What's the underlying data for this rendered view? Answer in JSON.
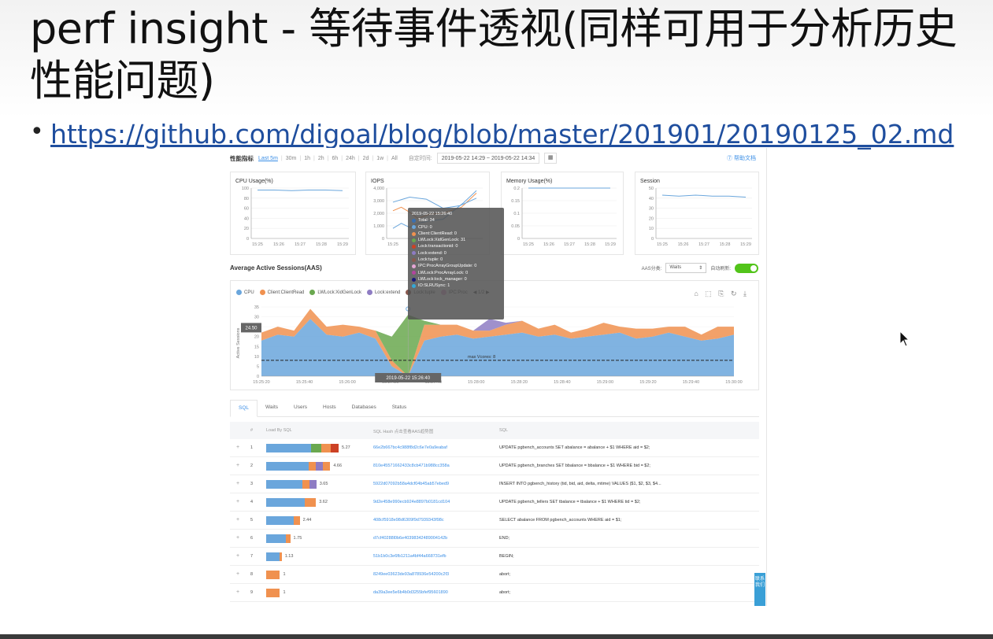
{
  "slide": {
    "title": "perf insight - 等待事件透视(同样可用于分析历史性能问题)",
    "bullet": "•",
    "link": "https://github.com/digoal/blog/blob/master/201901/20190125_02.md"
  },
  "dashboard": {
    "header_label": "性能指标",
    "ranges": [
      "Last 5m",
      "30m",
      "1h",
      "2h",
      "6h",
      "24h",
      "2d",
      "1w",
      "All"
    ],
    "custom_time_label": "自定时间:",
    "time_range": "2019-05-22 14:29  ~  2019-05-22 14:34",
    "calendar_icon": "calendar-icon",
    "help_label": "⑦ 帮助文档",
    "cards": [
      {
        "title": "CPU Usage(%)",
        "yticks": [
          "100",
          "80",
          "60",
          "40",
          "20",
          "0"
        ],
        "xticks": [
          "15:25",
          "15:26",
          "15:27",
          "15:28",
          "15:29"
        ]
      },
      {
        "title": "IOPS",
        "yticks": [
          "4,000",
          "3,000",
          "2,000",
          "1,000",
          "0"
        ],
        "xticks": [
          "15:25",
          "15:26"
        ]
      },
      {
        "title": "Memory Usage(%)",
        "yticks": [
          "0.2",
          "0.15",
          "0.1",
          "0.05",
          "0"
        ],
        "xticks": [
          "15:25",
          "15:26",
          "15:27",
          "15:28",
          "15:29"
        ]
      },
      {
        "title": "Session",
        "yticks": [
          "50",
          "40",
          "30",
          "20",
          "10",
          "0"
        ],
        "xticks": [
          "15:25",
          "15:26",
          "15:27",
          "15:28",
          "15:29"
        ]
      }
    ],
    "aas": {
      "title": "Average Active Sessions(AAS)",
      "dimension_label": "AAS分类:",
      "dimension_value": "Waits",
      "auto_refresh_label": "自动刷新:",
      "legend": [
        {
          "name": "CPU",
          "color": "#6aa6dc"
        },
        {
          "name": "Client:ClientRead",
          "color": "#f0914f"
        },
        {
          "name": "LWLock:XidGenLock",
          "color": "#6aa84f"
        },
        {
          "name": "Lock:extend",
          "color": "#8e7cc3"
        },
        {
          "name": "Lock:tuple",
          "color": "#8b5a4f"
        },
        {
          "name": "IPC:Proc",
          "color": "#e6a6d6"
        }
      ],
      "legend_pager": "◀ 1/2 ▶",
      "toolbox": "⌂ ⬚ ⎘ ↻ ⤓",
      "y_label": "Active Sessions",
      "yticks": [
        "35",
        "30",
        "25",
        "20",
        "15",
        "10",
        "5",
        "0"
      ],
      "xticks": [
        "15:25:20",
        "15:25:40",
        "15:26:00",
        "15:27:20",
        "15:27:40",
        "15:28:00",
        "15:28:20",
        "15:28:40",
        "15:29:00",
        "15:29:20",
        "15:29:40",
        "15:30:00"
      ],
      "pointer_value": "24.50",
      "pointer_time": "2019-05-22 15:26:40",
      "max_vcores_label": "max Vcores: 8"
    },
    "tooltip": {
      "time": "2019-05-22 15:26:40",
      "items": [
        {
          "text": "Total: 34",
          "color": "#3a6fb0"
        },
        {
          "text": "CPU: 0",
          "color": "#6aa6dc"
        },
        {
          "text": "Client:ClientRead: 0",
          "color": "#f0914f"
        },
        {
          "text": "LWLock:XidGenLock: 31",
          "color": "#6aa84f"
        },
        {
          "text": "Lock:transactionid: 0",
          "color": "#cc4125"
        },
        {
          "text": "Lock:extend: 0",
          "color": "#8e7cc3"
        },
        {
          "text": "Lock:tuple: 0",
          "color": "#8b5a4f"
        },
        {
          "text": "IPC:ProcArrayGroupUpdate: 0",
          "color": "#e6a6d6"
        },
        {
          "text": "LWLock:ProcArrayLock: 0",
          "color": "#b4449e"
        },
        {
          "text": "LWLock:lock_manager: 0",
          "color": "#1a1a7a"
        },
        {
          "text": "IO:SLRUSync: 1",
          "color": "#35a7d6"
        }
      ]
    },
    "tabs": [
      "SQL",
      "Waits",
      "Users",
      "Hosts",
      "Databases",
      "Status"
    ],
    "table": {
      "headers": [
        "#",
        "Load By SQL",
        "SQL Hash 点击查看AAS趋势图",
        "SQL"
      ],
      "rows": [
        {
          "num": "1",
          "load": "5.27",
          "hash": "66e2b667bc4c988f8d2c6e7e0a9eabaf",
          "sql": "UPDATE pgbench_accounts SET abalance = abalance + $1 WHERE aid = $2;",
          "bar": [
            [
              0.62,
              "#6aa6dc"
            ],
            [
              0.14,
              "#6aa84f"
            ],
            [
              0.13,
              "#f0914f"
            ],
            [
              0.11,
              "#cc4125"
            ]
          ]
        },
        {
          "num": "2",
          "load": "4.66",
          "hash": "810e45571662433c8cb471b988cc358a",
          "sql": "UPDATE pgbench_branches SET bbalance = bbalance + $1 WHERE bid = $2;",
          "bar": [
            [
              0.66,
              "#6aa6dc"
            ],
            [
              0.12,
              "#f0914f"
            ],
            [
              0.1,
              "#8e7cc3"
            ],
            [
              0.12,
              "#f0914f"
            ]
          ]
        },
        {
          "num": "3",
          "load": "3.65",
          "hash": "5922d07092b58a4dcf04b45ab57ebed9",
          "sql": "INSERT INTO pgbench_history (tid, bid, aid, delta, mtime) VALUES ($1, $2, $3, $4...",
          "bar": [
            [
              0.72,
              "#6aa6dc"
            ],
            [
              0.14,
              "#f0914f"
            ],
            [
              0.14,
              "#8e7cc3"
            ]
          ]
        },
        {
          "num": "4",
          "load": "3.62",
          "hash": "9d2e458e990ecb924e8897b0181cd104",
          "sql": "UPDATE pgbench_tellers SET tbalance = tbalance + $1 WHERE tid = $2;",
          "bar": [
            [
              0.78,
              "#6aa6dc"
            ],
            [
              0.22,
              "#f0914f"
            ]
          ]
        },
        {
          "num": "5",
          "load": "2.44",
          "hash": "408cf5918e98d6309f9d7939343f98c",
          "sql": "SELECT abalance FROM pgbench_accounts WHERE aid = $1;",
          "bar": [
            [
              0.82,
              "#6aa6dc"
            ],
            [
              0.18,
              "#f0914f"
            ]
          ]
        },
        {
          "num": "6",
          "load": "1.75",
          "hash": "d7cf40288l0b6e40398342489004142b",
          "sql": "END;",
          "bar": [
            [
              0.82,
              "#6aa6dc"
            ],
            [
              0.18,
              "#f0914f"
            ]
          ]
        },
        {
          "num": "7",
          "load": "1.13",
          "hash": "51b1b0c3e6fb1211a4bf44a668731efb",
          "sql": "BEGIN;",
          "bar": [
            [
              0.85,
              "#6aa6dc"
            ],
            [
              0.15,
              "#f0914f"
            ]
          ]
        },
        {
          "num": "8",
          "load": "1",
          "hash": "8249ee03623de93a878936e54200c2f3",
          "sql": "abort;",
          "bar": [
            [
              1.0,
              "#f0914f"
            ]
          ]
        },
        {
          "num": "9",
          "load": "1",
          "hash": "da39a3ee5e6b4b0d3255bfef95601890",
          "sql": "abort;",
          "bar": [
            [
              1.0,
              "#f0914f"
            ]
          ]
        }
      ]
    },
    "side_float": "联系我们"
  }
}
